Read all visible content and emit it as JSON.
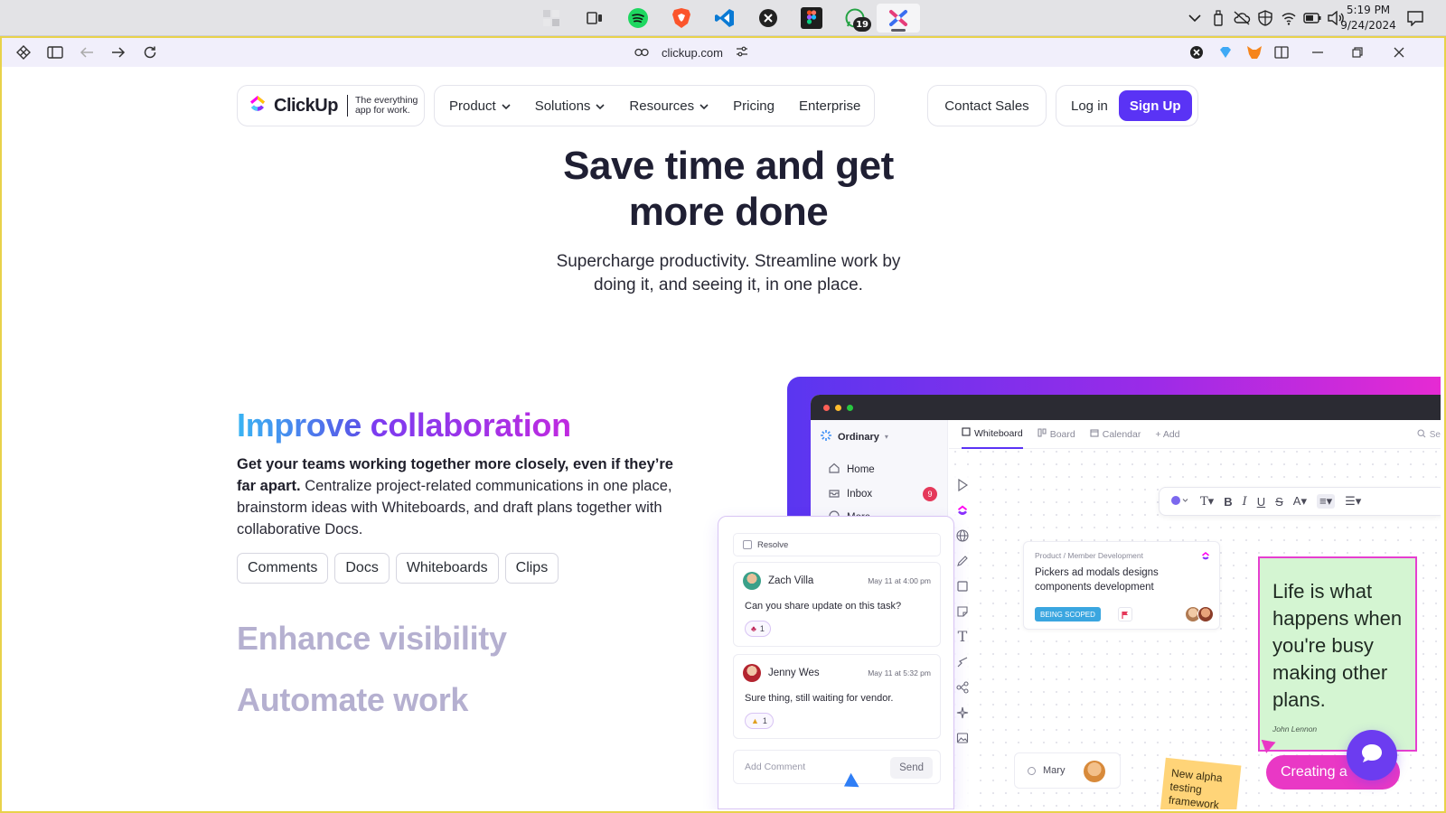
{
  "taskbar": {
    "apps": [
      {
        "name": "start-menu",
        "active": false
      },
      {
        "name": "task-view",
        "active": false
      },
      {
        "name": "spotify",
        "active": false
      },
      {
        "name": "brave",
        "active": false
      },
      {
        "name": "vscode",
        "active": false
      },
      {
        "name": "notion-like",
        "active": false
      },
      {
        "name": "figma",
        "active": false
      },
      {
        "name": "whatsapp",
        "active": false,
        "badge": "19"
      },
      {
        "name": "browser-current",
        "active": true
      }
    ],
    "whatsapp_badge": "19",
    "clock": {
      "time": "5:19 PM",
      "date": "9/24/2024"
    }
  },
  "browser": {
    "url": "clickup.com"
  },
  "site": {
    "logo": {
      "word": "ClickUp",
      "tagline": "The everything app for work."
    },
    "nav": {
      "product": "Product",
      "solutions": "Solutions",
      "resources": "Resources",
      "pricing": "Pricing",
      "enterprise": "Enterprise",
      "contact_sales": "Contact Sales",
      "login": "Log in",
      "signup": "Sign Up"
    },
    "hero": {
      "title_line1": "Save time and get",
      "title_line2": "more done",
      "subtitle_line1": "Supercharge productivity. Streamline work by",
      "subtitle_line2": "doing it, and seeing it, in one place."
    },
    "feature": {
      "title_word1": "Improve",
      "title_word2": "collaboration",
      "body_bold": "Get your teams working together more closely, even if they’re far apart.",
      "body_rest": " Centralize project-related communications in one place, brainstorm ideas with Whiteboards, and draft plans together with collaborative Docs.",
      "chips": [
        "Comments",
        "Docs",
        "Whiteboards",
        "Clips"
      ],
      "more": [
        "Enhance visibility",
        "Automate work"
      ]
    },
    "mockup": {
      "workspace": "Ordinary",
      "sidebar": [
        {
          "label": "Home"
        },
        {
          "label": "Inbox",
          "badge": "9"
        },
        {
          "label": "More"
        }
      ],
      "tabs": [
        "Whiteboard",
        "Board",
        "Calendar",
        "+ Add"
      ],
      "search": "Se",
      "task": {
        "crumb": "Product  /  Member Development",
        "title": "Pickers ad modals designs components development",
        "status": "BEING SCOPED"
      },
      "quote": {
        "text": "Life is what happens when you're busy making other plans.",
        "author": "John Lennon"
      },
      "mary": "Mary",
      "sticky": "New alpha testing framework",
      "creating": "Creating a"
    },
    "comments": {
      "resolve": "Resolve",
      "items": [
        {
          "name": "Zach Villa",
          "time": "May 11 at 4:00 pm",
          "text": "Can you share update on this task?",
          "reaction": "1"
        },
        {
          "name": "Jenny Wes",
          "time": "May 11 at 5:32 pm",
          "text": "Sure thing, still waiting for vendor.",
          "reaction": "1"
        }
      ],
      "add_placeholder": "Add Comment",
      "send": "Send"
    }
  },
  "colors": {
    "brand_purple": "#5a33f5",
    "gradient_start": "#5a36f0",
    "gradient_end": "#e62ad3",
    "quote_bg": "#d4f5d2",
    "status_blue": "#3aa6e0"
  }
}
